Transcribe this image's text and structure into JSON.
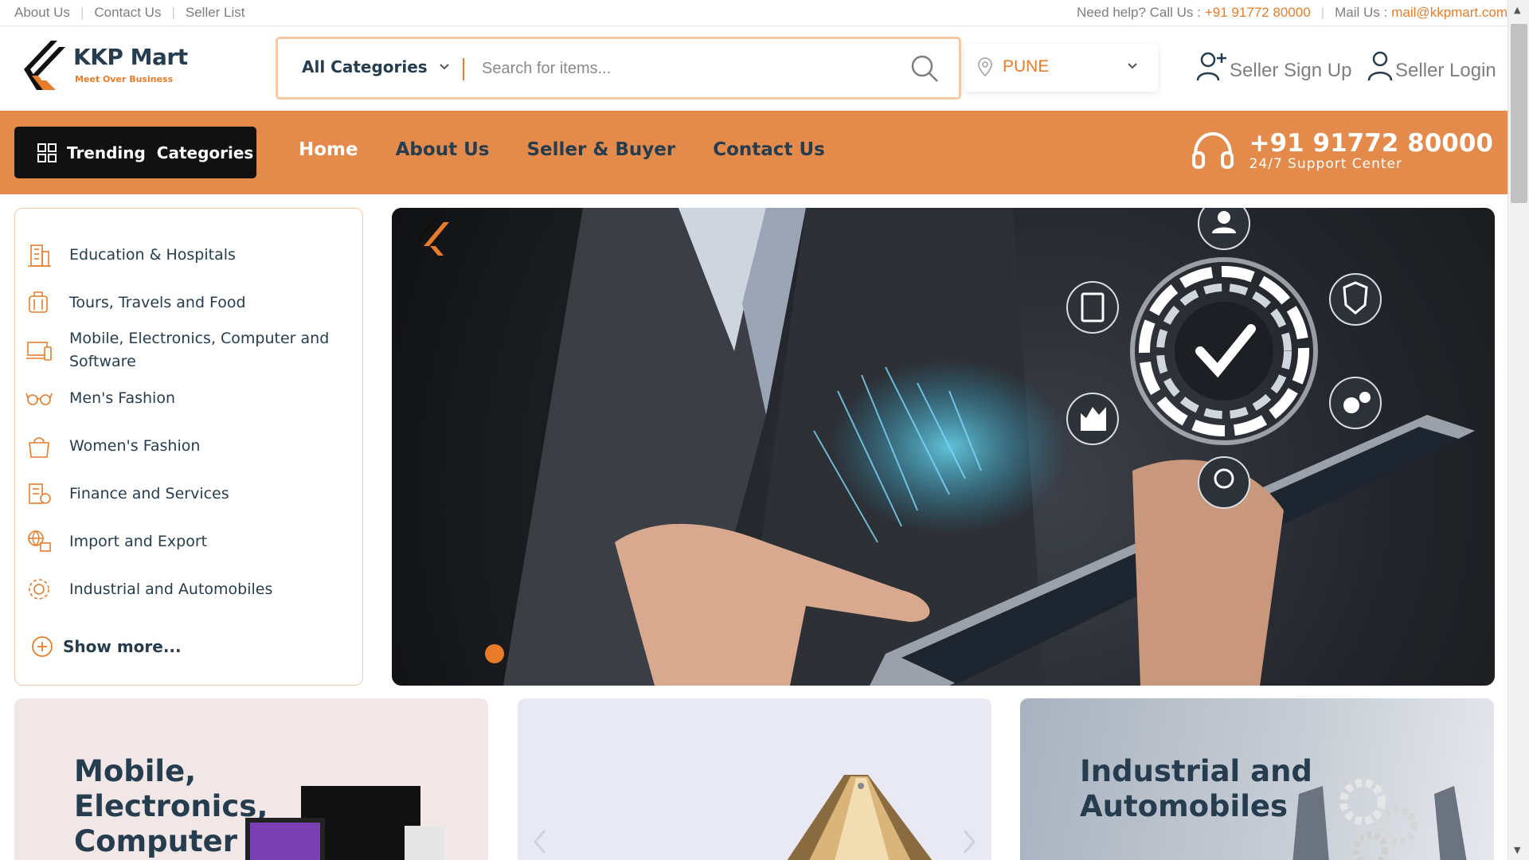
{
  "topbar": {
    "links": [
      "About Us",
      "Contact Us",
      "Seller List"
    ],
    "help_label": "Need help? Call Us :",
    "help_phone": "+91 91772 80000",
    "mail_label": "Mail Us :",
    "mail_value": "mail@kkpmart.com"
  },
  "header": {
    "brand": "KKP Mart",
    "tagline": "Meet Over Business",
    "category_select": "All Categories",
    "search_placeholder": "Search for items...",
    "location": "PUNE",
    "signup": "Seller Sign Up",
    "login": "Seller Login"
  },
  "nav": {
    "trending": "Trending  Categories",
    "links": [
      "Home",
      "About Us",
      "Seller & Buyer",
      "Contact Us"
    ],
    "active": "Home",
    "support_phone": "+91 91772 80000",
    "support_label": "24/7 Support Center"
  },
  "sidebar": {
    "items": [
      {
        "label": "Education & Hospitals",
        "icon": "building-icon"
      },
      {
        "label": "Tours, Travels and Food",
        "icon": "luggage-icon"
      },
      {
        "label": "Mobile, Electronics, Computer and Software",
        "icon": "devices-icon"
      },
      {
        "label": "Men's Fashion",
        "icon": "glasses-icon"
      },
      {
        "label": "Women's Fashion",
        "icon": "handbag-icon"
      },
      {
        "label": "Finance and Services",
        "icon": "finance-icon"
      },
      {
        "label": "Import and Export",
        "icon": "globe-icon"
      },
      {
        "label": "Industrial and Automobiles",
        "icon": "gear-icon"
      }
    ],
    "show_more": "Show more..."
  },
  "hero": {
    "brand": "KKP Mart",
    "tagline": "Meet Over Business"
  },
  "cards": [
    {
      "title": "Mobile, Electronics, Computer and Software"
    },
    {
      "title": ""
    },
    {
      "title": "Industrial and Automobiles"
    }
  ],
  "colors": {
    "accent": "#e87c2a",
    "nav_bg": "#e48a4a",
    "text": "#253d4e",
    "dark_button": "#111111"
  }
}
